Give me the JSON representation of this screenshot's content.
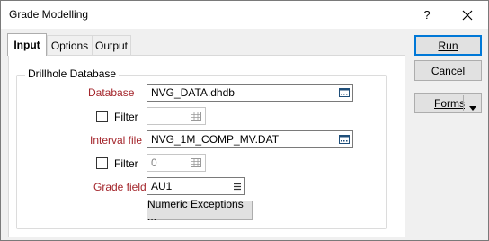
{
  "window": {
    "title": "Grade Modelling"
  },
  "titlebar": {
    "help_label": "?",
    "close_icon": "close-icon"
  },
  "tabs": [
    {
      "label": "Input",
      "active": true
    },
    {
      "label": "Options",
      "active": false
    },
    {
      "label": "Output",
      "active": false
    }
  ],
  "group": {
    "label": "Drillhole Database"
  },
  "form": {
    "database_label": "Database",
    "database_value": "NVG_DATA.dhdb",
    "filter1_label": "Filter",
    "filter1_value": "",
    "interval_label": "Interval file",
    "interval_value": "NVG_1M_COMP_MV.DAT",
    "filter2_label": "Filter",
    "filter2_value": "0",
    "grade_label": "Grade field",
    "grade_value": "AU1",
    "numeric_exceptions_label": "Numeric Exceptions ..."
  },
  "actions": {
    "run_label": "Run",
    "cancel_label": "Cancel",
    "forms_label": "Forms"
  },
  "colors": {
    "required_label": "#a4262c",
    "default_button_border": "#0078d7"
  }
}
